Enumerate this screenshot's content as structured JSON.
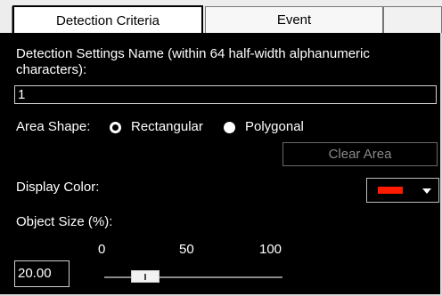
{
  "tabs": [
    {
      "label": "Detection Criteria",
      "active": true
    },
    {
      "label": "Event",
      "active": false
    }
  ],
  "settings_name": {
    "label": "Detection Settings Name (within 64 half-width alphanumeric characters):",
    "value": "1"
  },
  "area_shape": {
    "label": "Area Shape:",
    "options": [
      "Rectangular",
      "Polygonal"
    ],
    "selected": "Rectangular"
  },
  "clear_area": {
    "label": "Clear Area",
    "enabled": false
  },
  "display_color": {
    "label": "Display Color:",
    "value": "#ff1a00"
  },
  "object_size": {
    "label": "Object Size (%):",
    "value": "20.00",
    "slider": {
      "min": 0,
      "max": 100,
      "ticks": [
        "0",
        "50",
        "100"
      ],
      "value": 20
    }
  },
  "colors": {
    "background": "#000000",
    "text": "#ffffff",
    "disabled_text": "#8a8a8a",
    "tab_active_bg": "#ffffff",
    "swatch": "#ff1a00"
  }
}
